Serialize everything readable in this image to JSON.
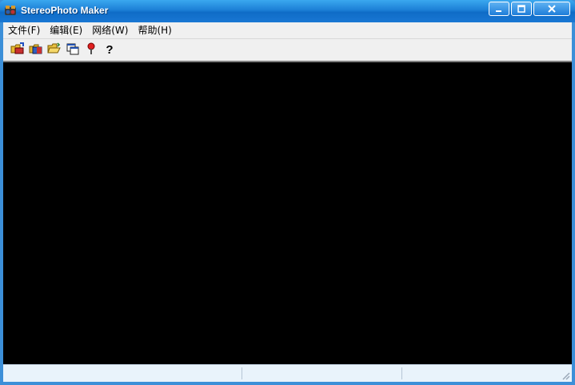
{
  "window": {
    "title": "StereoPhoto Maker"
  },
  "menu": {
    "items": [
      {
        "label": "文件(F)"
      },
      {
        "label": "编辑(E)"
      },
      {
        "label": "网络(W)"
      },
      {
        "label": "帮助(H)"
      }
    ]
  },
  "toolbar": {
    "help_label": "?"
  },
  "colors": {
    "titlebar": "#1c7fd6",
    "viewport": "#000000",
    "statusbar": "#e9f3fb"
  },
  "icons": [
    "app-icon",
    "open-stereo-pair-icon",
    "open-left-right-icon",
    "open-folder-icon",
    "window-layout-icon",
    "pin-icon",
    "help-icon",
    "minimize-icon",
    "maximize-icon",
    "close-icon"
  ]
}
